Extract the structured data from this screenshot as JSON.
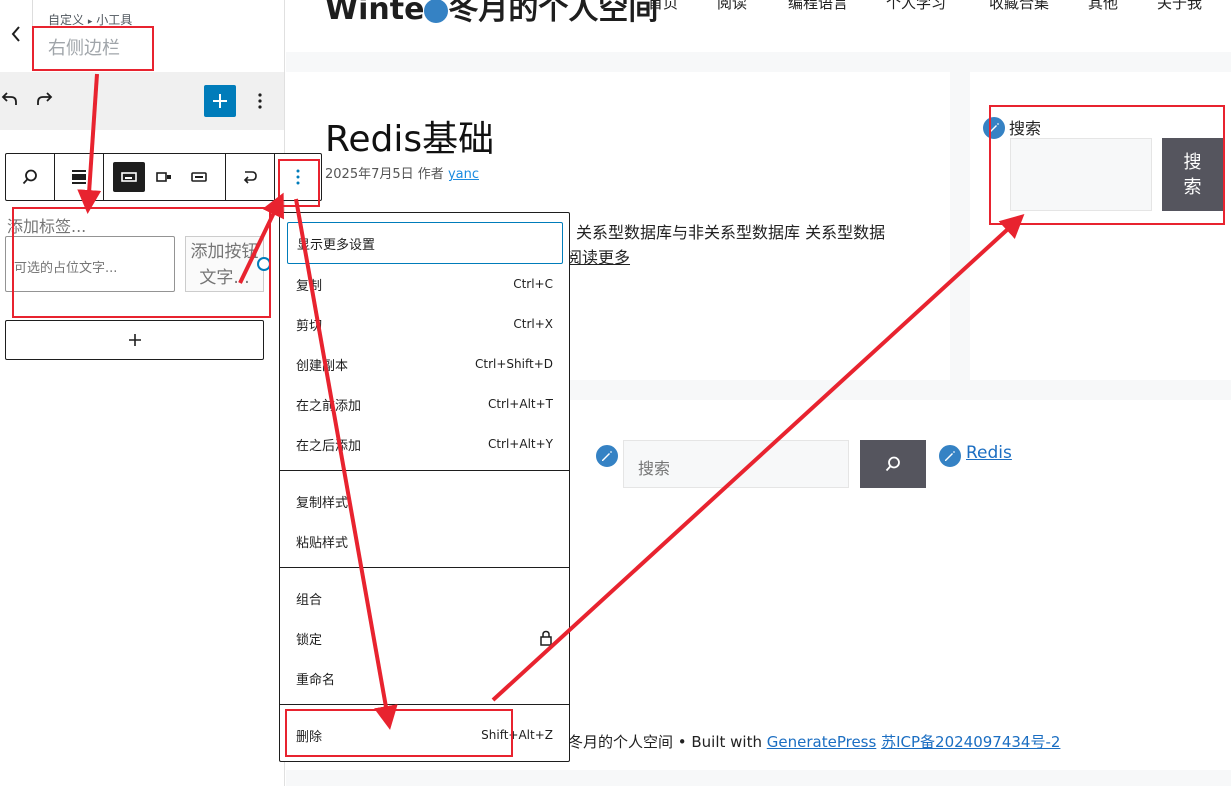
{
  "panel": {
    "breadcrumb_parent": "自定义",
    "breadcrumb_sep": "▸",
    "breadcrumb_child": "小工具",
    "title": "右侧边栏"
  },
  "block": {
    "label_placeholder": "添加标签...",
    "input_placeholder": "可选的占位文字...",
    "button_text": "添加按钮文字...",
    "appender": "+"
  },
  "menu": {
    "show_more": "显示更多设置",
    "items": [
      {
        "label": "复制",
        "shortcut": "Ctrl+C"
      },
      {
        "label": "剪切",
        "shortcut": "Ctrl+X"
      },
      {
        "label": "创建副本",
        "shortcut": "Ctrl+Shift+D"
      },
      {
        "label": "在之前添加",
        "shortcut": "Ctrl+Alt+T"
      },
      {
        "label": "在之后添加",
        "shortcut": "Ctrl+Alt+Y"
      }
    ],
    "style_items": [
      "复制样式",
      "粘贴样式"
    ],
    "group_items": [
      "组合",
      "锁定",
      "重命名"
    ],
    "delete": {
      "label": "删除",
      "shortcut": "Shift+Alt+Z"
    }
  },
  "site": {
    "logo_prefix": "Winte",
    "logo_suffix": "冬月的个人空间",
    "nav": [
      "首页",
      "阅读",
      "编程语言",
      "个人学习",
      "收藏合集",
      "其他",
      "关于我"
    ]
  },
  "post": {
    "title": "Redis基础",
    "date": "2025年7月5日",
    "author_prefix": "作者",
    "author": "yanc",
    "excerpt": "关系型数据库与非关系型数据库 关系型数据",
    "read_more": "阅读更多"
  },
  "sidebar": {
    "search_label": "搜索",
    "search_button": "搜索"
  },
  "footer": {
    "search_placeholder": "搜索",
    "link": "Redis",
    "credit_text": "冬月的个人空间 • Built with ",
    "credit_link1": "GeneratePress",
    "credit_link2": "苏ICP备2024097434号-2"
  },
  "colors": {
    "accent": "#007cba",
    "annotation": "#e8232f",
    "edit_shortcut": "#3582c4",
    "button_dark": "#55555e"
  }
}
